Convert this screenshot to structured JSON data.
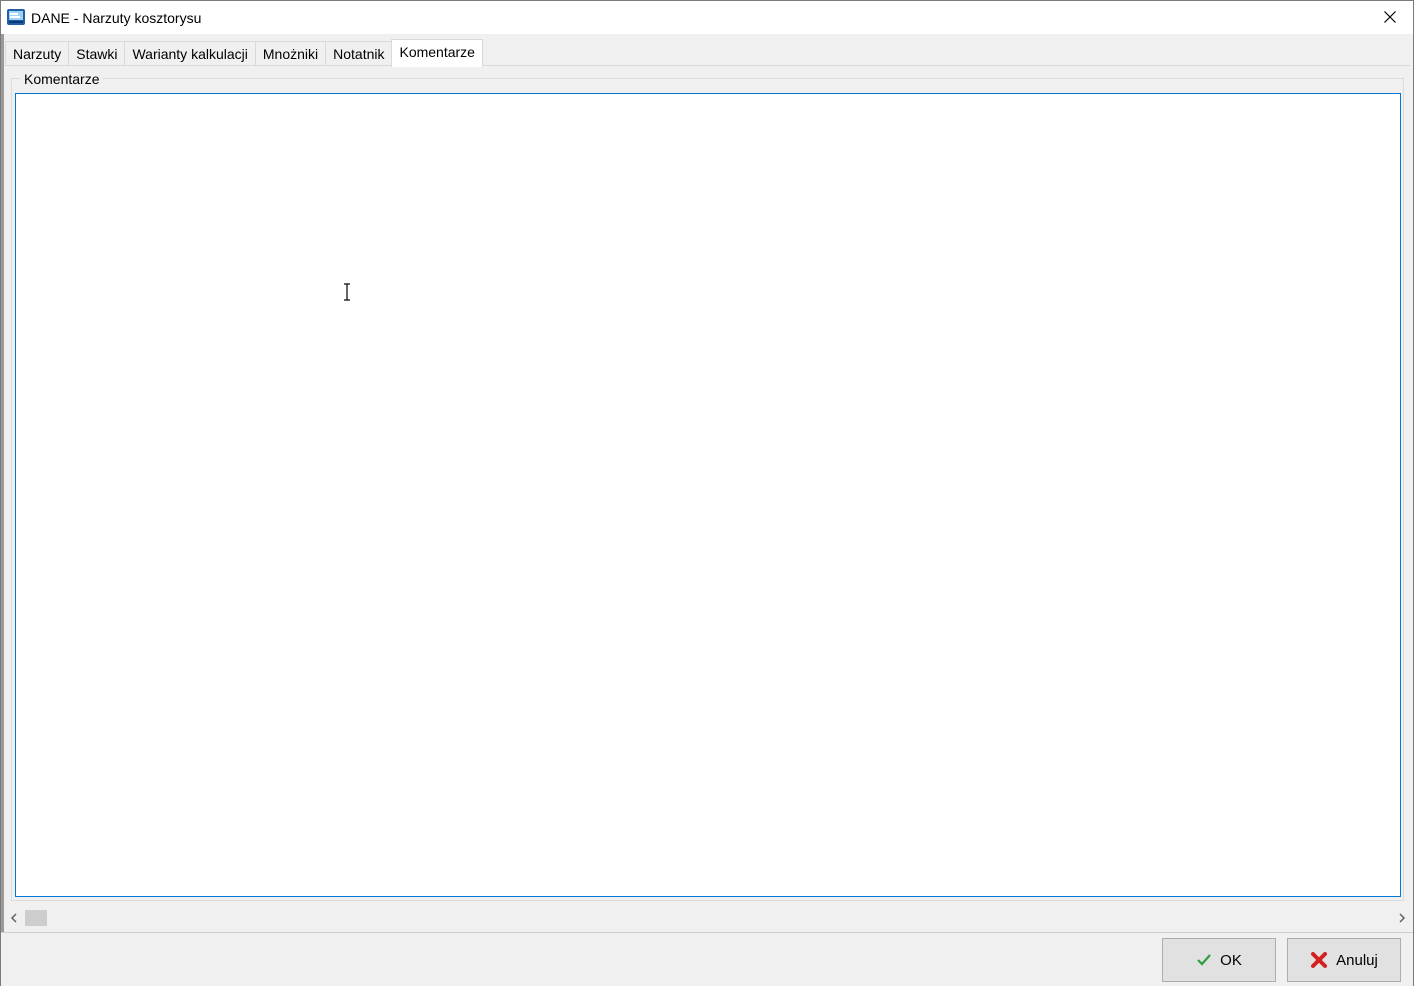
{
  "window": {
    "title": "DANE - Narzuty kosztorysu"
  },
  "tabs": [
    {
      "label": "Narzuty",
      "active": false
    },
    {
      "label": "Stawki",
      "active": false
    },
    {
      "label": "Warianty kalkulacji",
      "active": false
    },
    {
      "label": "Mnożniki",
      "active": false
    },
    {
      "label": "Notatnik",
      "active": false
    },
    {
      "label": "Komentarze",
      "active": true
    }
  ],
  "comments_panel": {
    "group_title": "Komentarze",
    "memo_value": ""
  },
  "buttons": {
    "ok_label": "OK",
    "cancel_label": "Anuluj"
  },
  "colors": {
    "focus_border": "#0078d7",
    "ok_icon": "#2e9e3e",
    "cancel_icon": "#d42020"
  },
  "icons": {
    "app": "app-icon",
    "close": "close-icon",
    "ok": "checkmark-icon",
    "cancel": "x-icon",
    "scroll_left": "chevron-left-icon",
    "scroll_right": "chevron-right-icon"
  }
}
